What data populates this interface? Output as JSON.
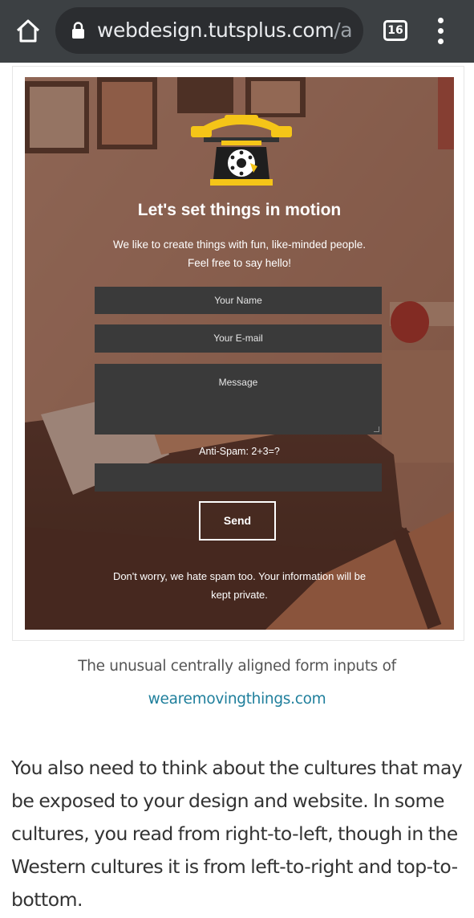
{
  "browser": {
    "url_host": "webdesign.tutsplus.com",
    "url_path": "/arti",
    "tab_count": "16",
    "icons": [
      "home-icon",
      "lock-icon",
      "tab-switcher-icon",
      "overflow-menu-icon"
    ]
  },
  "figure": {
    "form": {
      "heading": "Let's set things in motion",
      "subtitle_line1": "We like to create things with fun, like-minded people.",
      "subtitle_line2": "Feel free to say hello!",
      "name_placeholder": "Your Name",
      "email_placeholder": "Your E-mail",
      "message_placeholder": "Message",
      "antispam_label": "Anti-Spam: 2+3=?",
      "antispam_value": "",
      "send_label": "Send",
      "footer_line1": "Don't worry, we hate spam too. Your information will be",
      "footer_line2": "kept private."
    },
    "caption": "The unusual centrally aligned form inputs of",
    "caption_link": "wearemovingthings.com"
  },
  "article": {
    "paragraph": "You also need to think about the cultures that may be exposed to your design and website. In some cultures, you read from right-to-left, though in the Western cultures it is from left-to-right and top-to-bottom."
  },
  "colors": {
    "toolbar_bg": "#3c4043",
    "urlbar_bg": "#2b2d30",
    "link": "#1f7f9c",
    "field_bg": "#3a3a3a",
    "phone_accent": "#f5c518"
  }
}
